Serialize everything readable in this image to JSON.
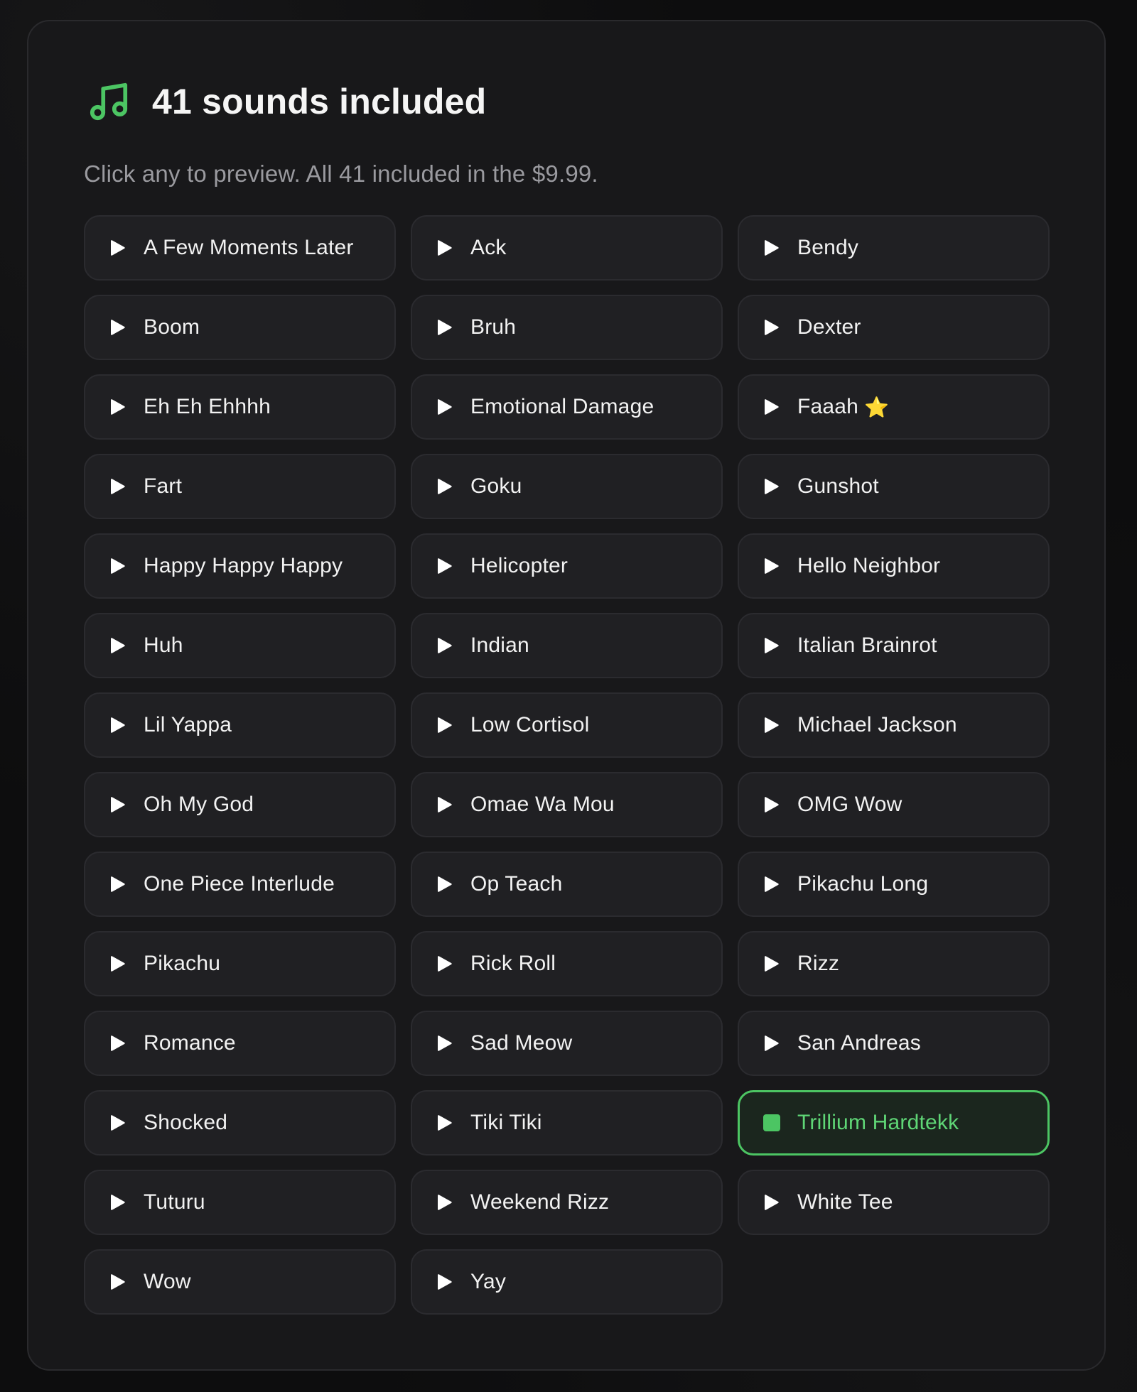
{
  "header": {
    "title": "41 sounds included",
    "subtitle": "Click any to preview. All 41 included in the $9.99.",
    "icon": "music-note-icon",
    "accent_color": "#4cc563"
  },
  "sounds": [
    {
      "label": "A Few Moments Later",
      "state": "idle"
    },
    {
      "label": "Ack",
      "state": "idle"
    },
    {
      "label": "Bendy",
      "state": "idle"
    },
    {
      "label": "Boom",
      "state": "idle"
    },
    {
      "label": "Bruh",
      "state": "idle"
    },
    {
      "label": "Dexter",
      "state": "idle"
    },
    {
      "label": "Eh Eh Ehhhh",
      "state": "idle"
    },
    {
      "label": "Emotional Damage",
      "state": "idle"
    },
    {
      "label": "Faaah",
      "state": "idle",
      "badge": "⭐"
    },
    {
      "label": "Fart",
      "state": "idle"
    },
    {
      "label": "Goku",
      "state": "idle"
    },
    {
      "label": "Gunshot",
      "state": "idle"
    },
    {
      "label": "Happy Happy Happy",
      "state": "idle"
    },
    {
      "label": "Helicopter",
      "state": "idle"
    },
    {
      "label": "Hello Neighbor",
      "state": "idle"
    },
    {
      "label": "Huh",
      "state": "idle"
    },
    {
      "label": "Indian",
      "state": "idle"
    },
    {
      "label": "Italian Brainrot",
      "state": "idle"
    },
    {
      "label": "Lil Yappa",
      "state": "idle"
    },
    {
      "label": "Low Cortisol",
      "state": "idle"
    },
    {
      "label": "Michael Jackson",
      "state": "idle"
    },
    {
      "label": "Oh My God",
      "state": "idle"
    },
    {
      "label": "Omae Wa Mou",
      "state": "idle"
    },
    {
      "label": "OMG Wow",
      "state": "idle"
    },
    {
      "label": "One Piece Interlude",
      "state": "idle"
    },
    {
      "label": "Op Teach",
      "state": "idle"
    },
    {
      "label": "Pikachu Long",
      "state": "idle"
    },
    {
      "label": "Pikachu",
      "state": "idle"
    },
    {
      "label": "Rick Roll",
      "state": "idle"
    },
    {
      "label": "Rizz",
      "state": "idle"
    },
    {
      "label": "Romance",
      "state": "idle"
    },
    {
      "label": "Sad Meow",
      "state": "idle"
    },
    {
      "label": "San Andreas",
      "state": "idle"
    },
    {
      "label": "Shocked",
      "state": "idle"
    },
    {
      "label": "Tiki Tiki",
      "state": "idle"
    },
    {
      "label": "Trillium Hardtekk",
      "state": "playing"
    },
    {
      "label": "Tuturu",
      "state": "idle"
    },
    {
      "label": "Weekend Rizz",
      "state": "idle"
    },
    {
      "label": "White Tee",
      "state": "idle"
    },
    {
      "label": "Wow",
      "state": "idle"
    },
    {
      "label": "Yay",
      "state": "idle"
    }
  ],
  "icons": {
    "idle": "play-icon",
    "playing": "stop-icon"
  }
}
